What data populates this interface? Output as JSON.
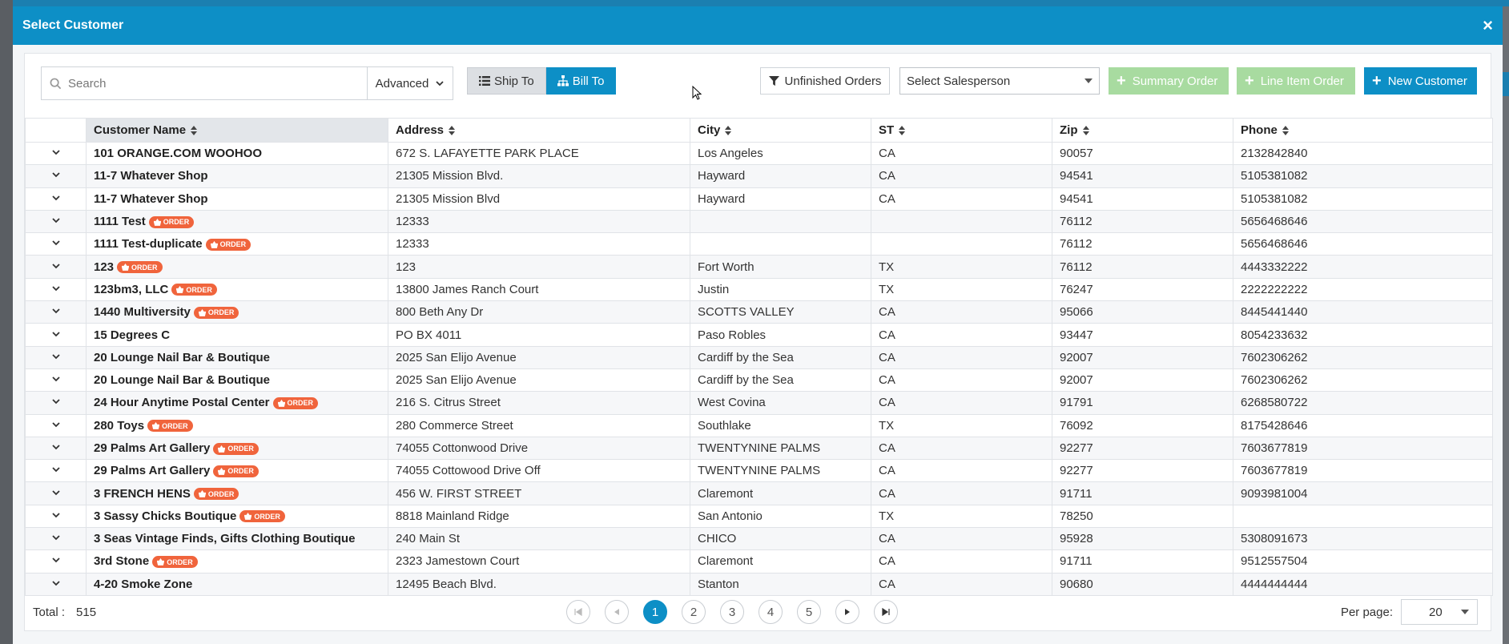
{
  "modal": {
    "title": "Select Customer",
    "close_label": "×"
  },
  "toolbar": {
    "search_placeholder": "Search",
    "advanced_label": "Advanced",
    "ship_to_label": "Ship To",
    "bill_to_label": "Bill To",
    "unfinished_orders_label": "Unfinished Orders",
    "salesperson_placeholder": "Select Salesperson",
    "summary_order_label": "Summary Order",
    "line_item_order_label": "Line Item Order",
    "new_customer_label": "New Customer"
  },
  "columns": [
    "Customer Name",
    "Address",
    "City",
    "ST",
    "Zip",
    "Phone"
  ],
  "badge_label": "ORDER",
  "rows": [
    {
      "name": "101 ORANGE.COM WOOHOO",
      "order": false,
      "address": "672 S. LAFAYETTE PARK PLACE",
      "city": "Los Angeles",
      "st": "CA",
      "zip": "90057",
      "phone": "2132842840"
    },
    {
      "name": "11-7 Whatever Shop",
      "order": false,
      "address": "21305 Mission Blvd.",
      "city": "Hayward",
      "st": "CA",
      "zip": "94541",
      "phone": "5105381082"
    },
    {
      "name": "11-7 Whatever Shop",
      "order": false,
      "address": "21305 Mission Blvd",
      "city": "Hayward",
      "st": "CA",
      "zip": "94541",
      "phone": "5105381082"
    },
    {
      "name": "1111 Test",
      "order": true,
      "address": "12333",
      "city": "",
      "st": "",
      "zip": "76112",
      "phone": "5656468646"
    },
    {
      "name": "1111 Test-duplicate",
      "order": true,
      "address": "12333",
      "city": "",
      "st": "",
      "zip": "76112",
      "phone": "5656468646"
    },
    {
      "name": "123",
      "order": true,
      "address": "123",
      "city": "Fort Worth",
      "st": "TX",
      "zip": "76112",
      "phone": "4443332222"
    },
    {
      "name": "123bm3, LLC",
      "order": true,
      "address": "13800 James Ranch Court",
      "city": "Justin",
      "st": "TX",
      "zip": "76247",
      "phone": "2222222222"
    },
    {
      "name": "1440 Multiversity",
      "order": true,
      "address": "800 Beth Any Dr",
      "city": "SCOTTS VALLEY",
      "st": "CA",
      "zip": "95066",
      "phone": "8445441440"
    },
    {
      "name": "15 Degrees C",
      "order": false,
      "address": "PO BX 4011",
      "city": "Paso Robles",
      "st": "CA",
      "zip": "93447",
      "phone": "8054233632"
    },
    {
      "name": "20 Lounge Nail Bar & Boutique",
      "order": false,
      "address": "2025 San Elijo Avenue",
      "city": "Cardiff by the Sea",
      "st": "CA",
      "zip": "92007",
      "phone": "7602306262"
    },
    {
      "name": "20 Lounge Nail Bar & Boutique",
      "order": false,
      "address": "2025 San Elijo Avenue",
      "city": "Cardiff by the Sea",
      "st": "CA",
      "zip": "92007",
      "phone": "7602306262"
    },
    {
      "name": "24 Hour Anytime Postal Center",
      "order": true,
      "address": "216 S. Citrus Street",
      "city": "West Covina",
      "st": "CA",
      "zip": "91791",
      "phone": "6268580722"
    },
    {
      "name": "280 Toys",
      "order": true,
      "address": "280 Commerce Street",
      "city": "Southlake",
      "st": "TX",
      "zip": "76092",
      "phone": "8175428646"
    },
    {
      "name": "29 Palms Art Gallery",
      "order": true,
      "address": "74055 Cottonwood Drive",
      "city": "TWENTYNINE PALMS",
      "st": "CA",
      "zip": "92277",
      "phone": "7603677819"
    },
    {
      "name": "29 Palms Art Gallery",
      "order": true,
      "address": "74055 Cottowood Drive Off",
      "city": "TWENTYNINE PALMS",
      "st": "CA",
      "zip": "92277",
      "phone": "7603677819"
    },
    {
      "name": "3 FRENCH HENS",
      "order": true,
      "address": "456 W. FIRST STREET",
      "city": "Claremont",
      "st": "CA",
      "zip": "91711",
      "phone": "9093981004"
    },
    {
      "name": "3 Sassy Chicks Boutique",
      "order": true,
      "address": "8818 Mainland Ridge",
      "city": "San Antonio",
      "st": "TX",
      "zip": "78250",
      "phone": ""
    },
    {
      "name": "3 Seas Vintage Finds, Gifts Clothing Boutique",
      "order": false,
      "address": "240 Main St",
      "city": "CHICO",
      "st": "CA",
      "zip": "95928",
      "phone": "5308091673"
    },
    {
      "name": "3rd Stone",
      "order": true,
      "address": "2323 Jamestown Court",
      "city": "Claremont",
      "st": "CA",
      "zip": "91711",
      "phone": "9512557504"
    },
    {
      "name": "4-20 Smoke Zone",
      "order": false,
      "address": "12495 Beach Blvd.",
      "city": "Stanton",
      "st": "CA",
      "zip": "90680",
      "phone": "4444444444"
    }
  ],
  "footer": {
    "total_label": "Total :",
    "total_value": "515",
    "pages": [
      "1",
      "2",
      "3",
      "4",
      "5"
    ],
    "current_page": "1",
    "per_page_label": "Per page:",
    "per_page_value": "20"
  }
}
